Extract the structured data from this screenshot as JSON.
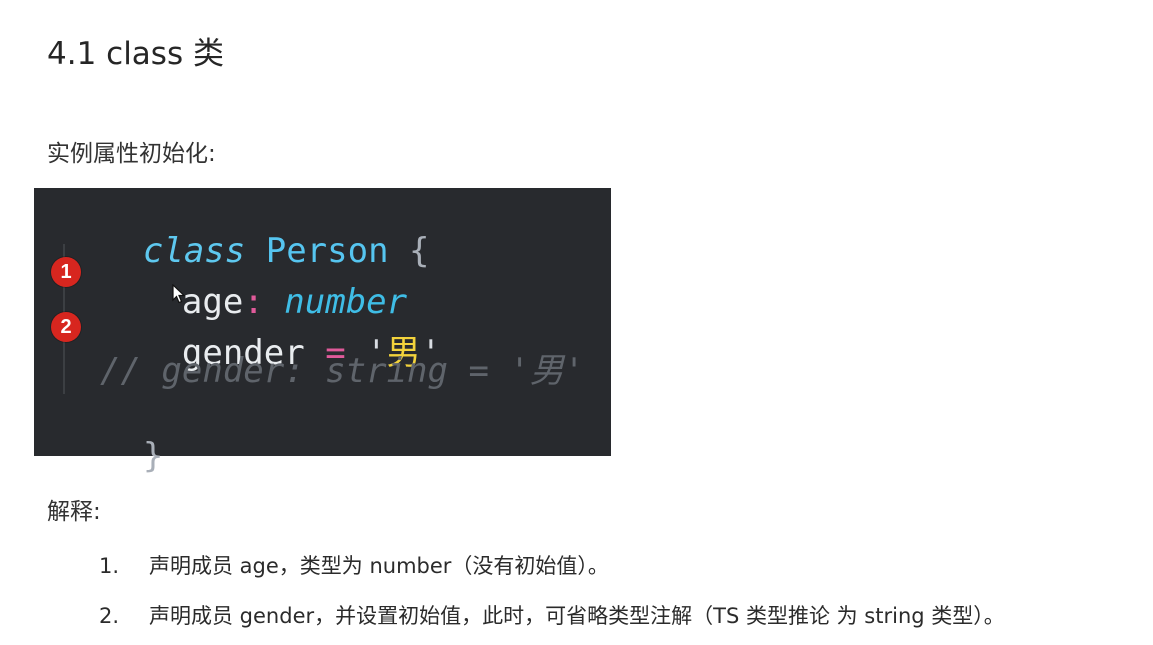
{
  "heading": "4.1 class 类",
  "subheading": "实例属性初始化:",
  "code": {
    "line1": {
      "keyword": "class",
      "name": "Person",
      "brace": "{"
    },
    "line2": {
      "prop": "age",
      "colon": ":",
      "type": "number"
    },
    "line3": {
      "prop": "gender",
      "op": "=",
      "quote_open": "'",
      "value": "男",
      "quote_close": "'"
    },
    "line4": {
      "comment": "// gender: string = '男'"
    },
    "line5": {
      "brace": "}"
    }
  },
  "markers": [
    "1",
    "2"
  ],
  "explain_label": "解释:",
  "list": [
    {
      "num": "1.",
      "text": "声明成员 age，类型为 number（没有初始值）。"
    },
    {
      "num": "2.",
      "text": "声明成员 gender，并设置初始值，此时，可省略类型注解（TS 类型推论 为 string 类型）。"
    }
  ],
  "colors": {
    "code_background": "#282a2e",
    "marker": "#d7261f",
    "string": "#f3d33c",
    "keyword": "#5ec8ef"
  }
}
